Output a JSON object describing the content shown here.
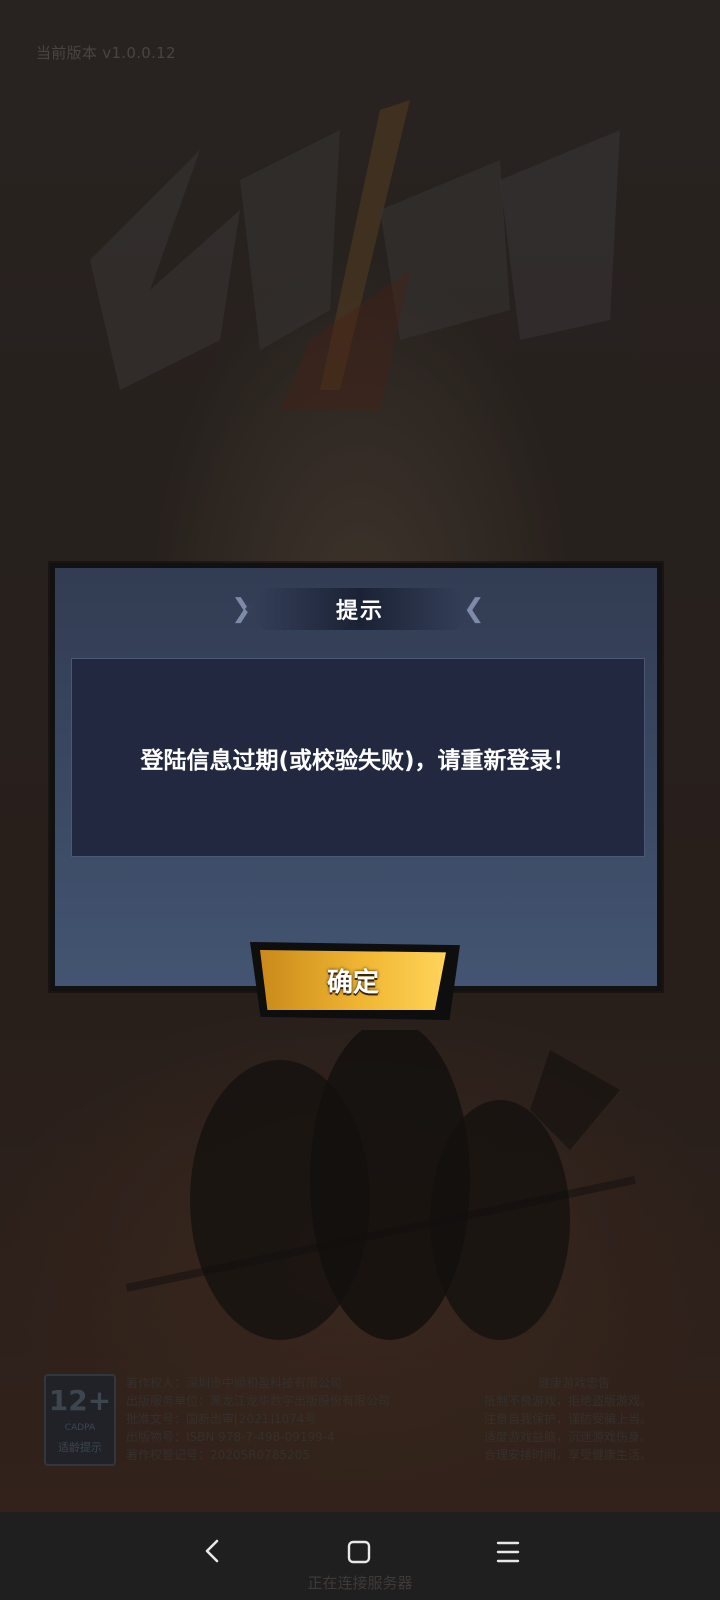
{
  "version_text": "当前版本 v1.0.0.12",
  "dialog": {
    "title": "提示",
    "message": "登陆信息过期(或校验失败)，请重新登录！",
    "confirm_label": "确定"
  },
  "footer": {
    "age_rating": {
      "number": "12+",
      "org": "CADPA",
      "tip": "适龄提示"
    },
    "credits": [
      "著作权人：深圳市中顺和盈科技有限公司",
      "出版服务单位：黑龙江龙华数字出版股份有限公司",
      "批准文号：国新出审[2021]1074号",
      "出版物号：ISBN 978-7-498-09199-4",
      "著作权登记号：2020SR0785205"
    ],
    "health_notice": {
      "title": "健康游戏忠告",
      "lines": [
        "抵制不良游戏，拒绝盗版游戏。",
        "注意自我保护，谨防受骗上当。",
        "适度游戏益脑，沉迷游戏伤身。",
        "合理安排时间，享受健康生活。"
      ]
    }
  },
  "status_text": "正在连接服务器",
  "colors": {
    "dialog_bg": "#3b4963",
    "message_box_bg": "#212840",
    "button_gold": "#f0b633",
    "navbar_bg": "#1f1f1f"
  },
  "icons": {
    "nav_back": "chevron-left-icon",
    "nav_home": "square-home-icon",
    "nav_menu": "hamburger-menu-icon"
  }
}
